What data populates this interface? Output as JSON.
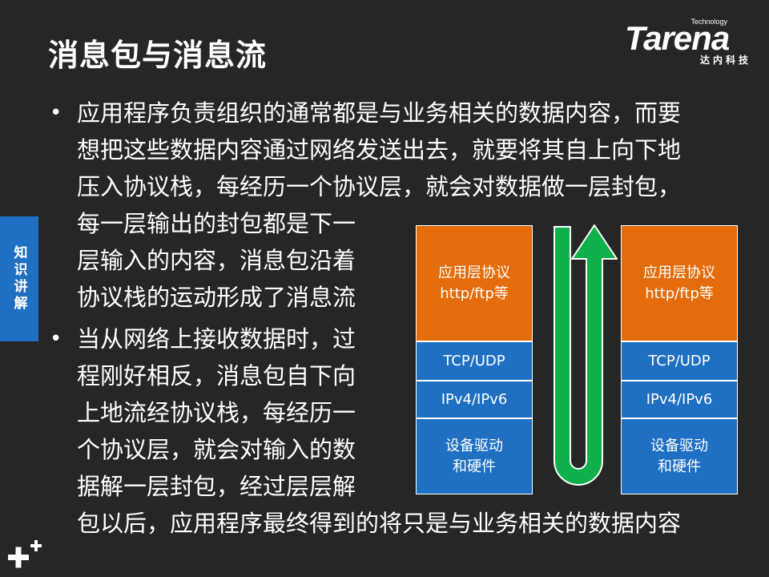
{
  "title": "消息包与消息流",
  "logo": {
    "tech": "Technology",
    "name": "Tarena",
    "cn": "达内科技"
  },
  "side_tab": "知识讲解",
  "bullets": {
    "marker": "•",
    "lines": [
      "应用程序负责组织的通常都是与业务相关的数据内容，而要",
      "想把这些数据内容通过网络发送出去，就要将其自上向下地",
      "压入协议栈，每经历一个协议层，就会对数据做一层封包，",
      "每一层输出的封包都是下一",
      "层输入的内容，消息包沿着",
      "协议栈的运动形成了消息流",
      "当从网络上接收数据时，过",
      "程刚好相反，消息包自下向",
      "上地流经协议栈，每经历一",
      "个协议层，就会对输入的数",
      "据解一层封包，经过层层解",
      "包以后，应用程序最终得到的将只是与业务相关的数据内容"
    ]
  },
  "stacks": {
    "left": {
      "app_line1": "应用层协议",
      "app_line2": "http/ftp等",
      "transport": "TCP/UDP",
      "network": "IPv4/IPv6",
      "driver_line1": "设备驱动",
      "driver_line2": "和硬件"
    },
    "right": {
      "app_line1": "应用层协议",
      "app_line2": "http/ftp等",
      "transport": "TCP/UDP",
      "network": "IPv4/IPv6",
      "driver_line1": "设备驱动",
      "driver_line2": "和硬件"
    }
  },
  "colors": {
    "background": "#262626",
    "application_layer": "#e46c0a",
    "network_layers": "#1f6fc2",
    "arrow": "#10b04a",
    "side_tab": "#1f6fc2"
  }
}
